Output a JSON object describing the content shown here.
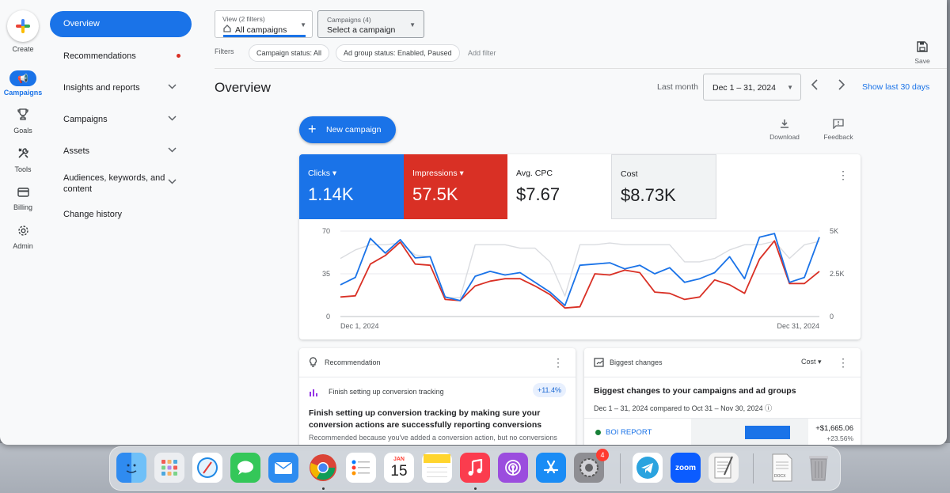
{
  "rail": {
    "create_label": "Create",
    "items": [
      {
        "label": "Campaigns"
      },
      {
        "label": "Goals"
      },
      {
        "label": "Tools"
      },
      {
        "label": "Billing"
      },
      {
        "label": "Admin"
      }
    ]
  },
  "nav": {
    "active": "Overview",
    "items": [
      {
        "label": "Recommendations"
      },
      {
        "label": "Insights and reports"
      },
      {
        "label": "Campaigns"
      },
      {
        "label": "Assets"
      },
      {
        "label": "Audiences, keywords, and content"
      },
      {
        "label": "Change history"
      }
    ]
  },
  "filterbar": {
    "view_small": "View (2 filters)",
    "view_value": "All campaigns",
    "campaigns_small": "Campaigns (4)",
    "campaigns_value": "Select a campaign",
    "filters_label": "Filters",
    "chips": [
      "Campaign status: All",
      "Ad group status: Enabled, Paused"
    ],
    "add_filter": "Add filter",
    "save_label": "Save"
  },
  "header": {
    "title": "Overview",
    "period_label": "Last month",
    "date_range": "Dec 1 – 31, 2024",
    "show_last": "Show last 30 days"
  },
  "actions": {
    "new_campaign": "New campaign",
    "download": "Download",
    "feedback": "Feedback"
  },
  "metrics": [
    {
      "name": "Clicks",
      "value": "1.14K",
      "color": "#1a73e8"
    },
    {
      "name": "Impressions",
      "value": "57.5K",
      "color": "#d93025"
    },
    {
      "name": "Avg. CPC",
      "value": "$7.67"
    },
    {
      "name": "Cost",
      "value": "$8.73K"
    }
  ],
  "chart": {
    "y_left_ticks": [
      "70",
      "35",
      "0"
    ],
    "y_right_ticks": [
      "5K",
      "2.5K",
      "0"
    ],
    "x_start": "Dec 1, 2024",
    "x_end": "Dec 31, 2024"
  },
  "chart_data": {
    "type": "line",
    "x": [
      "Dec 1",
      "Dec 2",
      "Dec 3",
      "Dec 4",
      "Dec 5",
      "Dec 6",
      "Dec 7",
      "Dec 8",
      "Dec 9",
      "Dec 10",
      "Dec 11",
      "Dec 12",
      "Dec 13",
      "Dec 14",
      "Dec 15",
      "Dec 16",
      "Dec 17",
      "Dec 18",
      "Dec 19",
      "Dec 20",
      "Dec 21",
      "Dec 22",
      "Dec 23",
      "Dec 24",
      "Dec 25",
      "Dec 26",
      "Dec 27",
      "Dec 28",
      "Dec 29",
      "Dec 30",
      "Dec 31"
    ],
    "ylim": [
      0,
      70
    ],
    "y2lim": [
      0,
      5000
    ],
    "series": [
      {
        "name": "Clicks",
        "axis": "left",
        "color": "#1a73e8",
        "values": [
          26,
          32,
          64,
          52,
          63,
          48,
          49,
          16,
          13,
          33,
          37,
          34,
          36,
          28,
          20,
          9,
          42,
          43,
          44,
          39,
          42,
          35,
          40,
          28,
          31,
          36,
          49,
          31,
          65,
          68,
          28,
          32,
          65
        ]
      },
      {
        "name": "Impressions",
        "axis": "left",
        "color": "#d93025",
        "values": [
          16,
          17,
          43,
          50,
          61,
          43,
          42,
          14,
          13,
          25,
          29,
          31,
          31,
          25,
          18,
          7,
          8,
          35,
          34,
          38,
          36,
          20,
          19,
          14,
          16,
          30,
          26,
          19,
          47,
          62,
          27,
          27,
          37
        ]
      },
      {
        "name": "Cost",
        "axis": "right",
        "color": "#dadce0",
        "values": [
          3400,
          3900,
          4200,
          4200,
          4300,
          3600,
          3500,
          1100,
          1100,
          4200,
          4200,
          4200,
          4000,
          4000,
          3200,
          1200,
          4200,
          4200,
          4300,
          4200,
          4200,
          4200,
          4200,
          3200,
          3200,
          3400,
          3900,
          4200,
          4200,
          4400,
          3400,
          4200,
          4400
        ]
      }
    ]
  },
  "recommendation": {
    "header": "Recommendation",
    "item": "Finish setting up conversion tracking",
    "badge": "+11.4%",
    "title": "Finish setting up conversion tracking by making sure your conversion actions are successfully reporting conversions",
    "note": "Recommended because you've added a conversion action, but no conversions"
  },
  "changes": {
    "header": "Biggest changes",
    "metric_select": "Cost",
    "title": "Biggest changes to your campaigns and ad groups",
    "subtitle": "Dec 1 – 31, 2024 compared to Oct 31 – Nov 30, 2024",
    "row_name": "BOI REPORT",
    "row_value": "+$1,665.06",
    "row_pct": "+23.56%"
  },
  "dock": {
    "calendar_month": "JAN",
    "calendar_day": "15",
    "settings_badge": "4",
    "zoom_label": "zoom",
    "doc_label": "DOCX",
    "items": [
      "finder-icon",
      "launchpad-icon",
      "safari-icon",
      "messages-icon",
      "mail-icon",
      "chrome-icon",
      "reminders-icon",
      "calendar-icon",
      "notes-icon",
      "music-icon",
      "podcasts-icon",
      "app-store-icon",
      "system-settings-icon",
      "telegram-icon",
      "zoom-icon",
      "textedit-icon",
      "document-icon",
      "trash-icon"
    ]
  }
}
